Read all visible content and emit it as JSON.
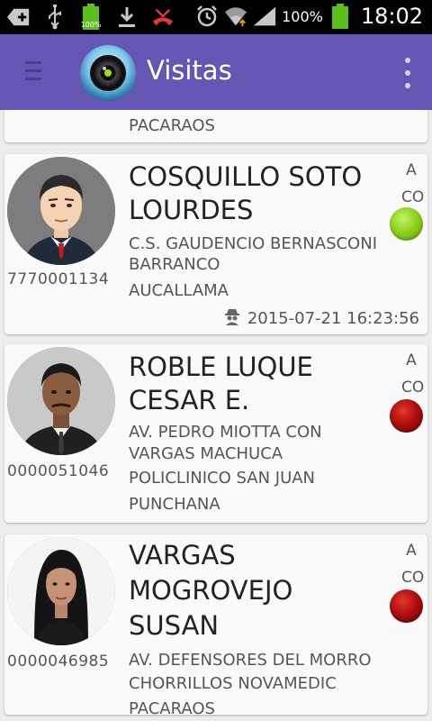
{
  "status_bar": {
    "battery_small_label": "100%",
    "signal_pct": "100%",
    "time": "18:02"
  },
  "app_bar": {
    "title": "Visitas"
  },
  "cards": [
    {
      "partial": true,
      "addr_lines": [
        "PACARAOS"
      ]
    },
    {
      "name_lines": [
        "COSQUILLO SOTO",
        "LOURDES"
      ],
      "code": "7770001134",
      "addr_lines": [
        "C.S. GAUDENCIO BERNASCONI",
        "BARRANCO",
        "AUCALLAMA"
      ],
      "flag_lines": [
        "A",
        "CO"
      ],
      "status_color": "green",
      "timestamp": "2015-07-21 16:23:56"
    },
    {
      "name_lines": [
        "ROBLE LUQUE",
        "CESAR E."
      ],
      "code": "0000051046",
      "addr_lines": [
        "AV. PEDRO MIOTTA CON",
        "VARGAS MACHUCA",
        "POLICLINICO SAN JUAN",
        "PUNCHANA"
      ],
      "flag_lines": [
        "A",
        "CO"
      ],
      "status_color": "red"
    },
    {
      "name_lines": [
        "VARGAS",
        "MOGROVEJO",
        "SUSAN"
      ],
      "code": "0000046985",
      "addr_lines": [
        "AV. DEFENSORES DEL MORRO",
        "CHORRILLOS NOVAMEDIC",
        "PACARAOS"
      ],
      "flag_lines": [
        "A",
        "CO"
      ],
      "status_color": "red"
    }
  ],
  "colors": {
    "app_bar": "#6456b3",
    "status_green": "#8fd21c",
    "status_red": "#b10e0e"
  },
  "icons": [
    "usb-debug-icon",
    "usb-icon",
    "battery-icon",
    "download-icon",
    "missed-call-icon",
    "alarm-icon",
    "wifi-icon",
    "signal-icon",
    "menu-icon",
    "app-logo-icon",
    "overflow-menu-icon",
    "spy-icon"
  ]
}
